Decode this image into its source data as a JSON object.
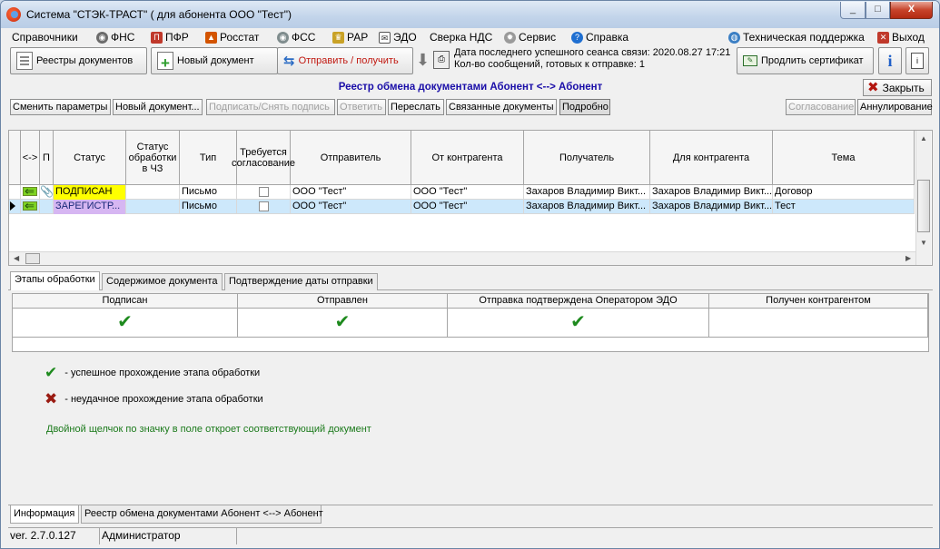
{
  "window": {
    "title": "Система \"СТЭК-ТРАСТ\" ( для абонента ООО \"Тест\")",
    "min": "_",
    "max": "□",
    "close": "X"
  },
  "menu": [
    {
      "label": "Справочники",
      "icon": ""
    },
    {
      "label": "ФНС",
      "icon": "fns-icon"
    },
    {
      "label": "ПФР",
      "icon": "pfr-icon"
    },
    {
      "label": "Росстат",
      "icon": "rosstat-icon"
    },
    {
      "label": "ФСС",
      "icon": "fss-icon"
    },
    {
      "label": "РАР",
      "icon": "rar-icon"
    },
    {
      "label": "ЭДО",
      "icon": "edo-icon"
    },
    {
      "label": "Сверка НДС",
      "icon": ""
    },
    {
      "label": "Сервис",
      "icon": "gear-icon"
    },
    {
      "label": "Справка",
      "icon": "help-icon"
    },
    {
      "label": "Техническая поддержка",
      "icon": "globe-icon"
    },
    {
      "label": "Выход",
      "icon": "exit-icon"
    }
  ],
  "toolbar": {
    "registers": "Реестры документов",
    "new_doc": "Новый документ",
    "send": "Отправить / получить",
    "session_line1": "Дата последнего успешного сеанса связи: 2020.08.27 17:21",
    "session_line2": "Кол-во сообщений, готовых к отправке: 1",
    "renew_cert": "Продлить сертификат"
  },
  "section": {
    "title": "Реестр обмена документами Абонент <--> Абонент",
    "close": "Закрыть"
  },
  "actions": {
    "change_params": "Сменить параметры",
    "new_doc": "Новый документ...",
    "sign": "Подписать/Снять подпись",
    "reply": "Ответить",
    "forward": "Переслать",
    "linked": "Связанные документы",
    "details": "Подробно",
    "approval": "Согласование",
    "cancel": "Аннулирование"
  },
  "grid": {
    "columns": [
      "",
      "<->",
      "П",
      "Статус",
      "Статус обработки в ЧЗ",
      "Тип",
      "Требуется согласование",
      "Отправитель",
      "От контрагента",
      "Получатель",
      "Для контрагента",
      "Тема"
    ],
    "rows": [
      {
        "status": "ПОДПИСАН",
        "cz": "",
        "type": "Письмо",
        "sender": "ООО \"Тест\"",
        "from": "ООО \"Тест\"",
        "recipient": "Захаров Владимир Викт...",
        "for": "Захаров Владимир Викт...",
        "subject": "Договор"
      },
      {
        "status": "ЗАРЕГИСТР...",
        "cz": "",
        "type": "Письмо",
        "sender": "ООО \"Тест\"",
        "from": "ООО \"Тест\"",
        "recipient": "Захаров Владимир Викт...",
        "for": "Захаров Владимир Викт...",
        "subject": "Тест"
      }
    ]
  },
  "tabs": [
    "Этапы обработки",
    "Содержимое документа",
    "Подтверждение даты отправки"
  ],
  "stages": {
    "columns": [
      "Подписан",
      "Отправлен",
      "Отправка подтверждена Оператором ЭДО",
      "Получен контрагентом"
    ],
    "marks": [
      "✔",
      "✔",
      "✔",
      ""
    ]
  },
  "legend": {
    "success": "-  успешное прохождение этапа обработки",
    "fail": "-  неудачное прохождение этапа обработки",
    "hint": "Двойной щелчок по значку в поле откроет соответствующий документ"
  },
  "bottom_tabs": [
    "Информация",
    "Реестр обмена документами Абонент <--> Абонент"
  ],
  "status": {
    "version": "ver. 2.7.0.127",
    "user": "Администратор"
  },
  "colors": {
    "signed": "#ffff00",
    "registered": "#d6b6f2",
    "title_blue": "#1a0ea8",
    "hint_green": "#1b7a1b"
  }
}
